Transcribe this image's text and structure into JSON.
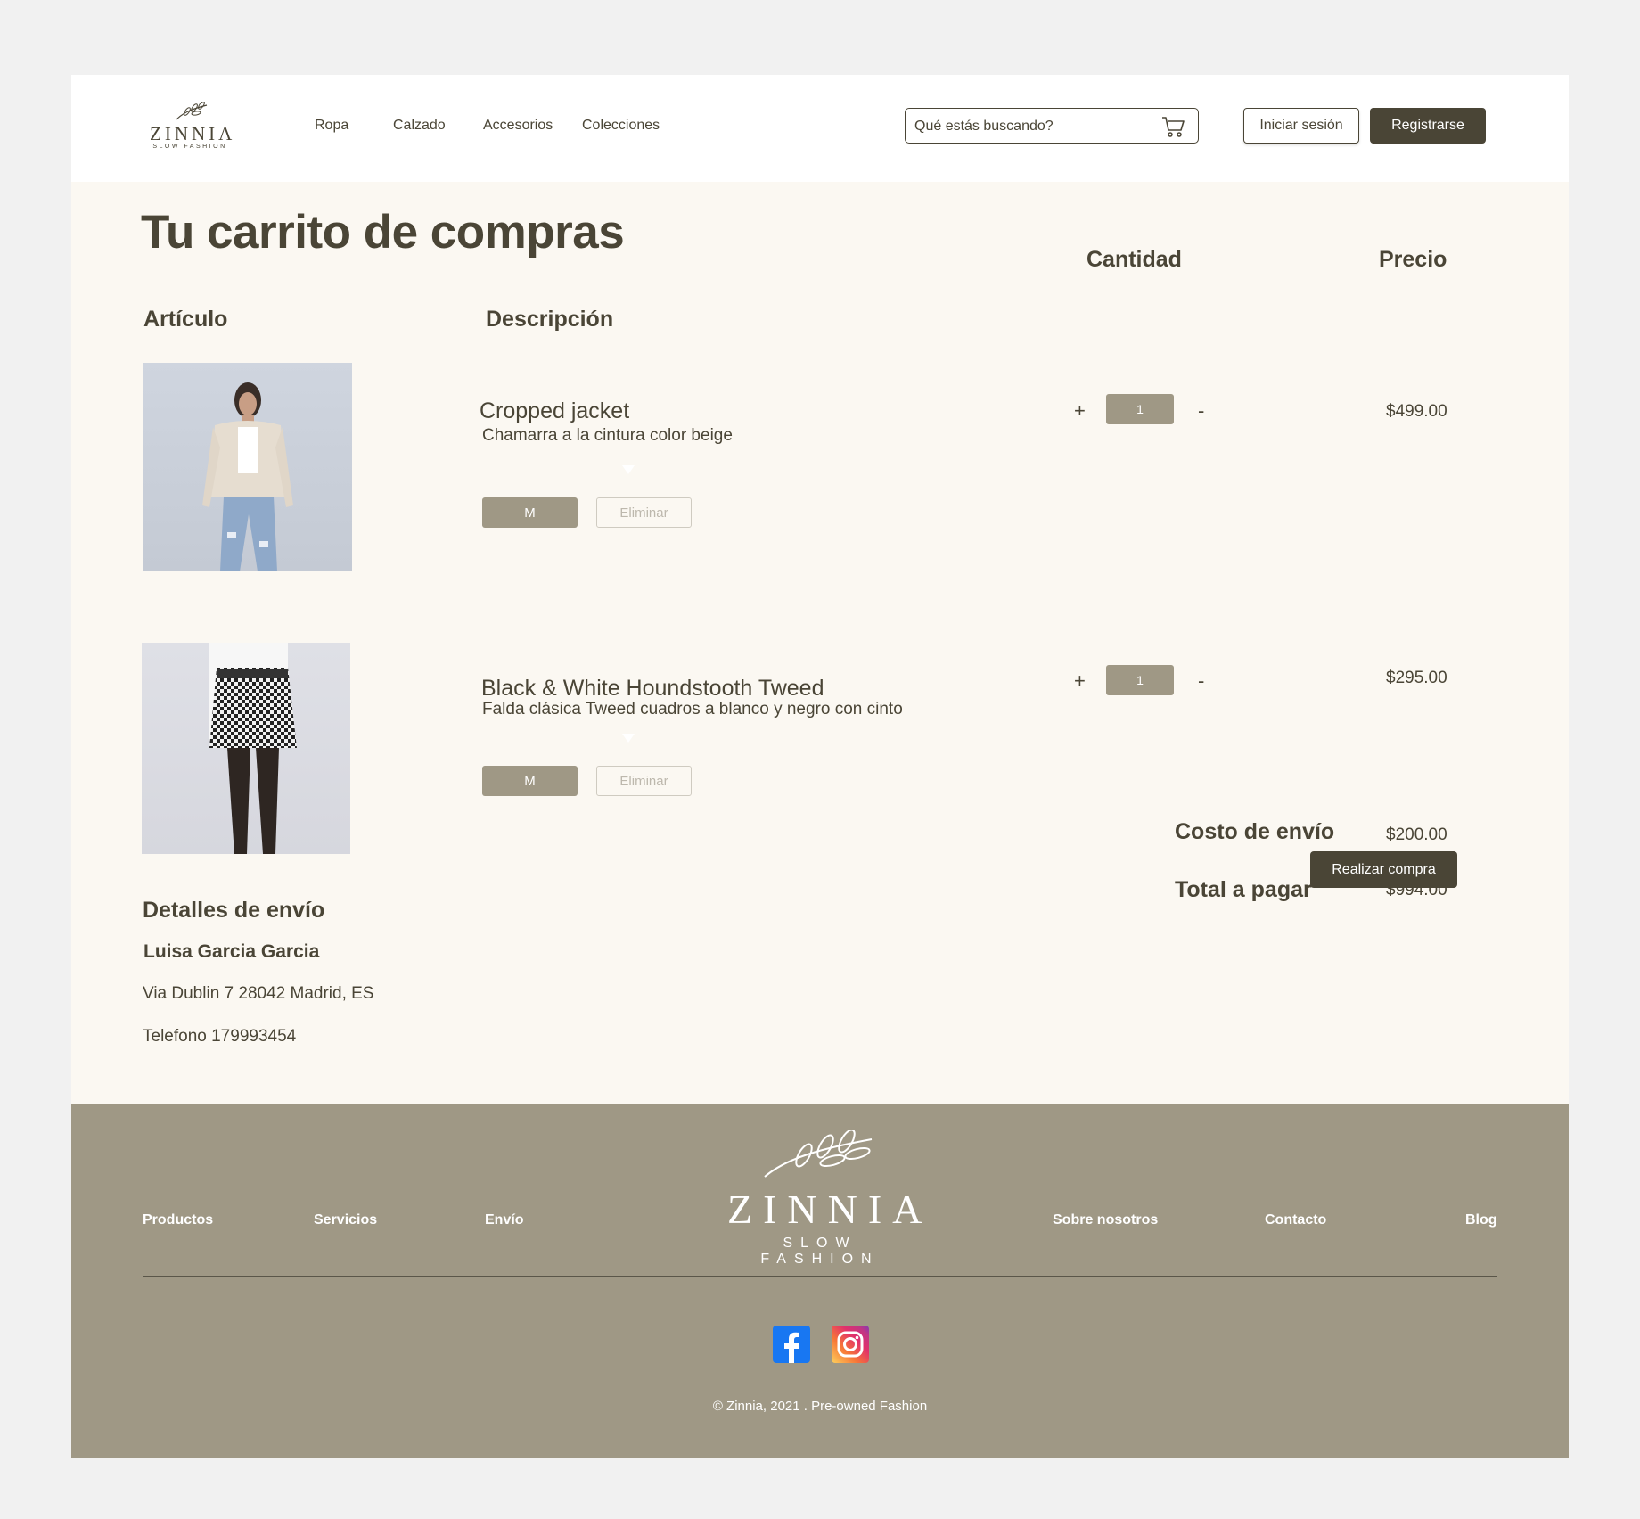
{
  "header": {
    "brand": "ZINNIA",
    "tagline": "SLOW FASHION",
    "nav": [
      "Ropa",
      "Calzado",
      "Accesorios",
      "Colecciones"
    ],
    "search_placeholder": "Qué estás buscando?",
    "login_label": "Iniciar sesión",
    "register_label": "Registrarse"
  },
  "cart": {
    "title": "Tu carrito de compras",
    "col_article": "Artículo",
    "col_description": "Descripción",
    "col_quantity": "Cantidad",
    "col_price": "Precio",
    "remove_label": "Eliminar",
    "plus": "+",
    "minus": "-",
    "items": [
      {
        "name": "Cropped jacket",
        "description": "Chamarra a la cintura color beige",
        "size": "M",
        "quantity": "1",
        "price": "$499.00"
      },
      {
        "name": "Black & White Houndstooth Tweed",
        "description": "Falda clásica Tweed cuadros a blanco y negro con cinto",
        "size": "M",
        "quantity": "1",
        "price": "$295.00"
      }
    ],
    "shipping_label": "Costo de envío",
    "shipping_value": "$200.00",
    "total_label": "Total a pagar",
    "total_value": "$994.00",
    "buy_label": "Realizar compra"
  },
  "shipping_details": {
    "heading": "Detalles de envío",
    "name": "Luisa Garcia Garcia",
    "address": "Via Dublin 7 28042 Madrid, ES",
    "phone": "Telefono 179993454"
  },
  "footer": {
    "links_left": [
      "Productos",
      "Servicios",
      "Envío"
    ],
    "links_right": [
      "Sobre nosotros",
      "Contacto",
      "Blog"
    ],
    "brand": "ZINNIA",
    "tagline": "SLOW FASHION",
    "copyright": "©  Zinnia, 2021 . Pre-owned Fashion"
  },
  "colors": {
    "dark": "#4a4536",
    "accent": "#9f9885",
    "cream": "#fbf8f2"
  }
}
